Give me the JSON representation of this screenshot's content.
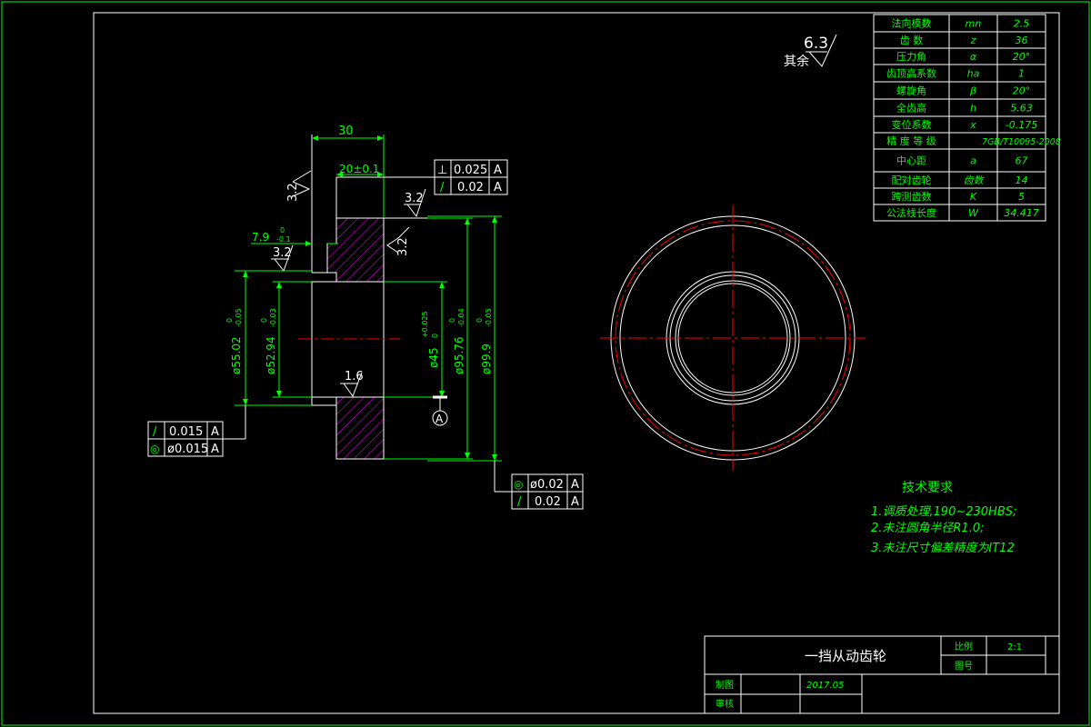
{
  "colors": {
    "background": "#000000",
    "frame": "#00ff00",
    "dimension": "#00ff00",
    "outline": "#ffffff",
    "centerline": "#ff0000",
    "hatch": "#ff00ff",
    "text_white": "#ffffff"
  },
  "roughness": {
    "general": "6.3",
    "general_label": "其余",
    "face_left": "3.2",
    "top_face": "3.2",
    "face_right": "3.2",
    "hub_left": "3.2",
    "bore": "1.6"
  },
  "dimensions": {
    "width_30": "30",
    "hub_20": "20±0.1",
    "step_7_9": "7.9",
    "step_7_9_tol_upper": "0",
    "step_7_9_tol_lower": "-0.1",
    "d55": "ø55.02",
    "d55_upper": "0",
    "d55_lower": "-0.05",
    "d52": "ø52.94",
    "d52_upper": "0",
    "d52_lower": "-0.03",
    "d45": "ø45",
    "d45_upper": "+0.025",
    "d45_lower": "0",
    "d95": "ø95.76",
    "d95_upper": "0",
    "d95_lower": "-0.04",
    "d99": "ø99.9",
    "d99_upper": "0",
    "d99_lower": "-0.05"
  },
  "tolerance_frames": {
    "top": [
      {
        "symbol": "⊥",
        "value": "0.025",
        "datum": "A"
      },
      {
        "symbol": "/",
        "value": "0.02",
        "datum": "A"
      }
    ],
    "left": [
      {
        "symbol": "/",
        "value": "0.015",
        "datum": "A"
      },
      {
        "symbol": "◎",
        "value": "ø0.015",
        "datum": "A"
      }
    ],
    "bottom": [
      {
        "symbol": "◎",
        "value": "ø0.02",
        "datum": "A"
      },
      {
        "symbol": "/",
        "value": "0.02",
        "datum": "A"
      }
    ],
    "datum_label": "A"
  },
  "gear_table": [
    {
      "name": "法向模数",
      "symbol": "mn",
      "value": "2.5"
    },
    {
      "name": "齿  数",
      "symbol": "z",
      "value": "36"
    },
    {
      "name": "压力角",
      "symbol": "α",
      "value": "20°"
    },
    {
      "name": "齿顶高系数",
      "symbol": "ha",
      "value": "1"
    },
    {
      "name": "螺旋角",
      "symbol": "β",
      "value": "20°"
    },
    {
      "name": "全齿高",
      "symbol": "h",
      "value": "5.63"
    },
    {
      "name": "变位系数",
      "symbol": "x",
      "value": "-0.175"
    },
    {
      "name": "精 度 等 级",
      "symbol": "",
      "value": "7GB/T10095-2008"
    },
    {
      "name": "中心距",
      "symbol": "a",
      "value": "67"
    },
    {
      "name": "配对齿轮",
      "symbol": "齿数",
      "value": "14"
    },
    {
      "name": "跨测齿数",
      "symbol": "K",
      "value": "5"
    },
    {
      "name": "公法线长度",
      "symbol": "W",
      "value": "34.417"
    }
  ],
  "tech_requirements": {
    "title": "技术要求",
    "items": [
      "1.调质处理,190~230HBS;",
      "2.未注圆角半径R1.0;",
      "3.未注尺寸偏差精度为IT12"
    ]
  },
  "title_block": {
    "part_name": "一挡从动齿轮",
    "scale_label": "比例",
    "scale_value": "2:1",
    "drawing_no_label": "图号",
    "drawn_label": "制图",
    "date": "2017.05",
    "checked_label": "审核"
  }
}
